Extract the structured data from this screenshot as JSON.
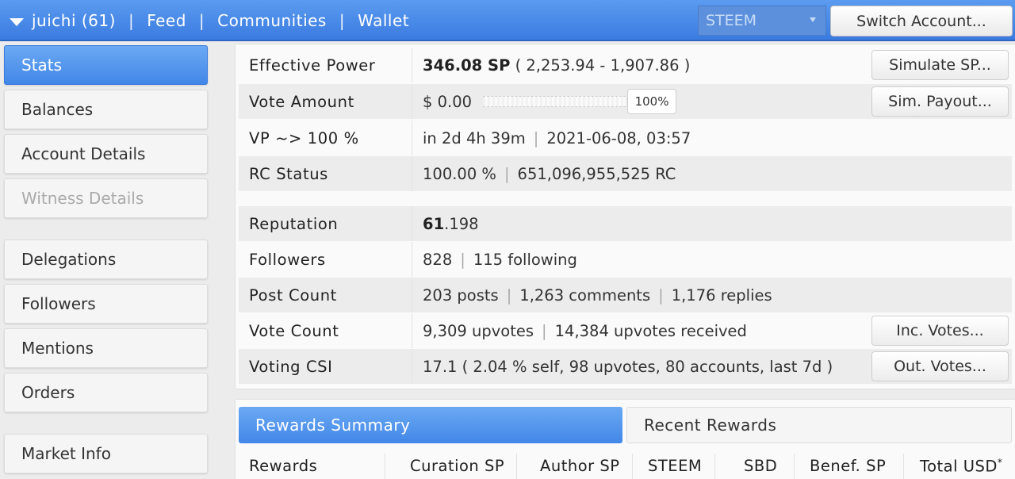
{
  "topbar": {
    "account": "juichi (61)",
    "nav": [
      "Feed",
      "Communities",
      "Wallet"
    ],
    "chain": "STEEM",
    "switch_label": "Switch Account..."
  },
  "sidebar": {
    "items": [
      "Stats",
      "Balances",
      "Account Details",
      "Witness Details",
      "Delegations",
      "Followers",
      "Mentions",
      "Orders",
      "Market Info"
    ]
  },
  "stats": {
    "effective_power": {
      "label": "Effective Power",
      "value": "346.08 SP",
      "detail": "( 2,253.94 - 1,907.86 )",
      "button": "Simulate SP..."
    },
    "vote_amount": {
      "label": "Vote Amount",
      "value": "$ 0.00",
      "percent": "100%",
      "button": "Sim. Payout..."
    },
    "vp": {
      "label": "VP ~> 100 %",
      "time": "in 2d 4h 39m",
      "date": "2021-06-08, 03:57"
    },
    "rc": {
      "label": "RC Status",
      "pct": "100.00 %",
      "amount": "651,096,955,525 RC"
    },
    "reputation": {
      "label": "Reputation",
      "whole": "61",
      "decimal": ".198"
    },
    "followers": {
      "label": "Followers",
      "count": "828",
      "following": "115 following"
    },
    "post_count": {
      "label": "Post Count",
      "posts": "203 posts",
      "comments": "1,263 comments",
      "replies": "1,176 replies"
    },
    "vote_count": {
      "label": "Vote Count",
      "upvotes": "9,309 upvotes",
      "received": "14,384 upvotes received",
      "button": "Inc. Votes..."
    },
    "csi": {
      "label": "Voting CSI",
      "value": "17.1 ( 2.04 % self, 98 upvotes, 80 accounts, last 7d )",
      "button": "Out. Votes..."
    }
  },
  "rewards": {
    "tab_active": "Rewards Summary",
    "tab_inactive": "Recent Rewards",
    "columns": [
      "Rewards",
      "Curation SP",
      "Author SP",
      "STEEM",
      "SBD",
      "Benef. SP",
      "Total USD"
    ],
    "total_mark": "*"
  }
}
